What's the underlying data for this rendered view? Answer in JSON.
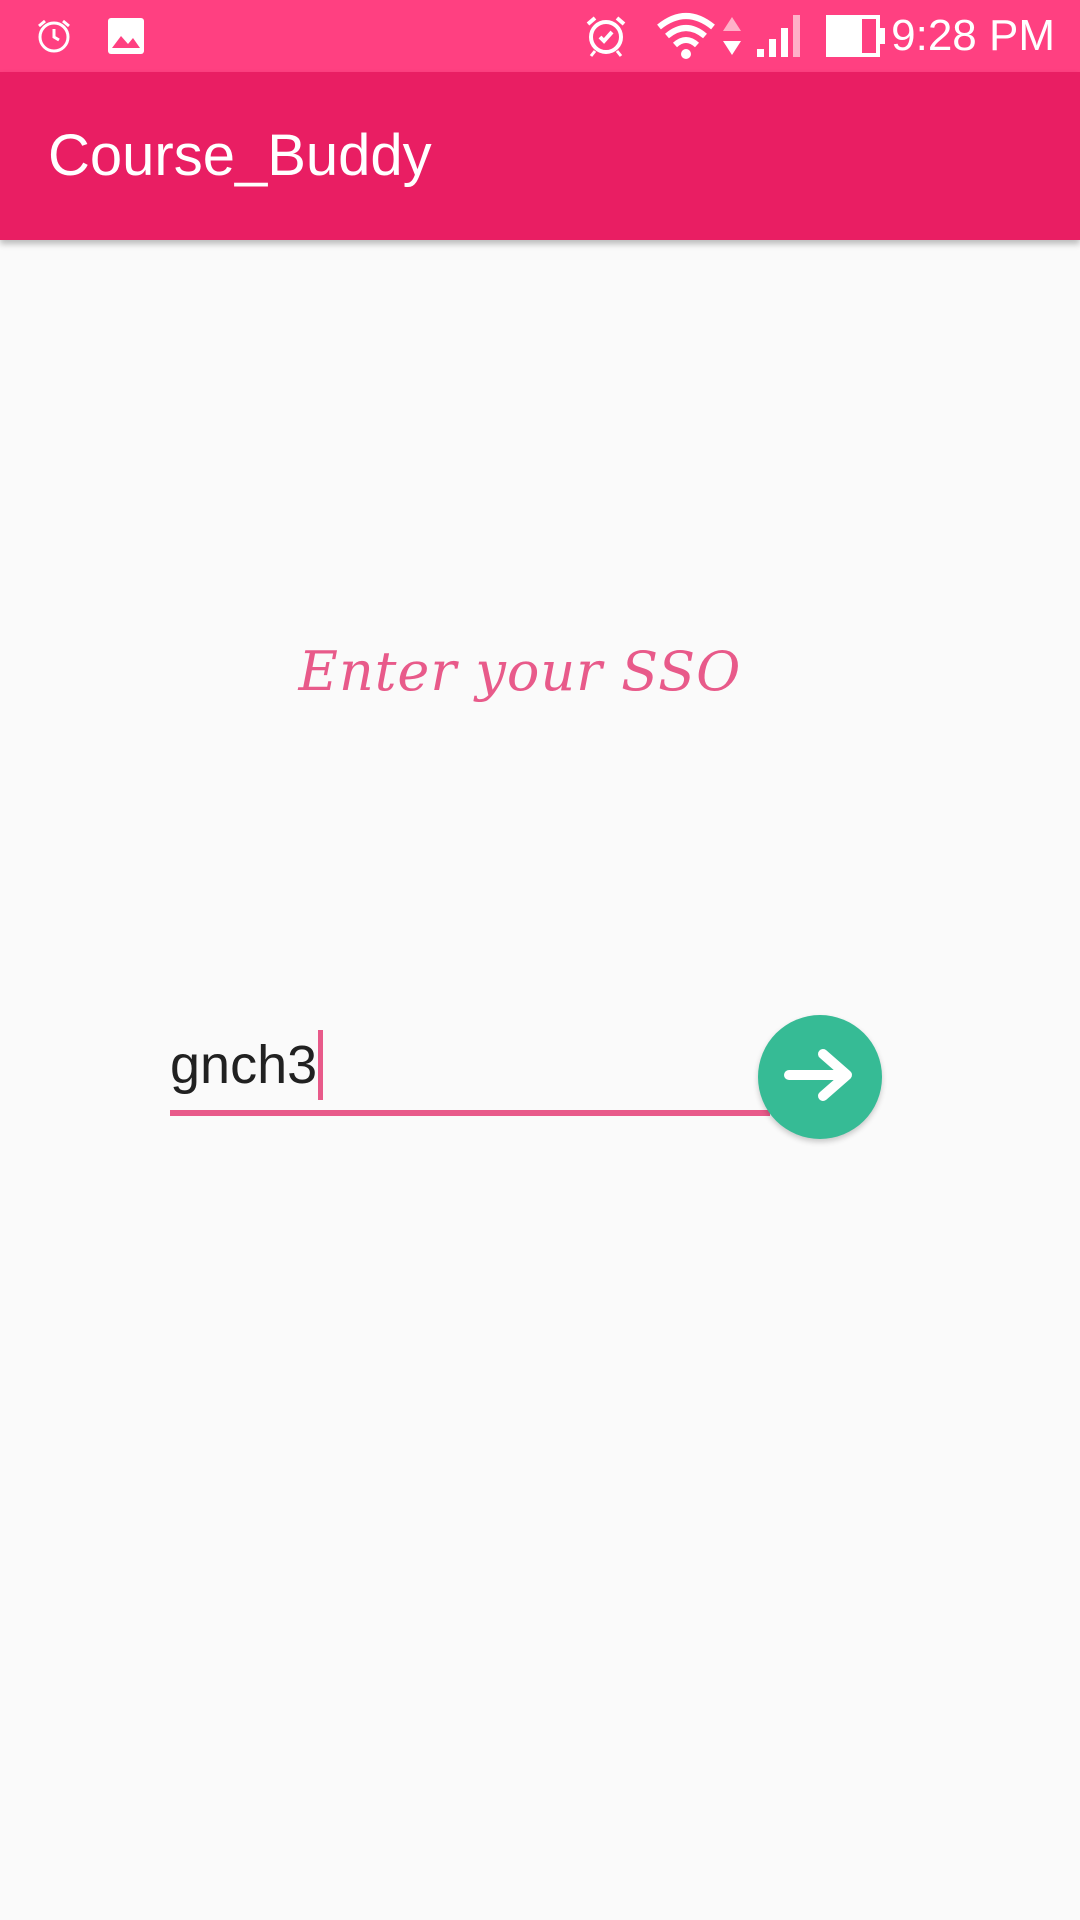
{
  "status_bar": {
    "time": "9:28 PM",
    "icons": [
      "alarm-icon",
      "image-icon",
      "alarm-clock-icon",
      "wifi-icon",
      "data-arrows-icon",
      "signal-icon",
      "battery-icon"
    ],
    "background": "#ff4081"
  },
  "app_bar": {
    "title": "Course_Buddy",
    "background": "#e91e63"
  },
  "main": {
    "prompt": "Enter your SSO",
    "sso_input": {
      "value": "gnch3",
      "placeholder": ""
    },
    "submit_button": {
      "icon": "arrow-right-icon",
      "color": "#36bb95"
    },
    "accent": "#e85a8a"
  }
}
